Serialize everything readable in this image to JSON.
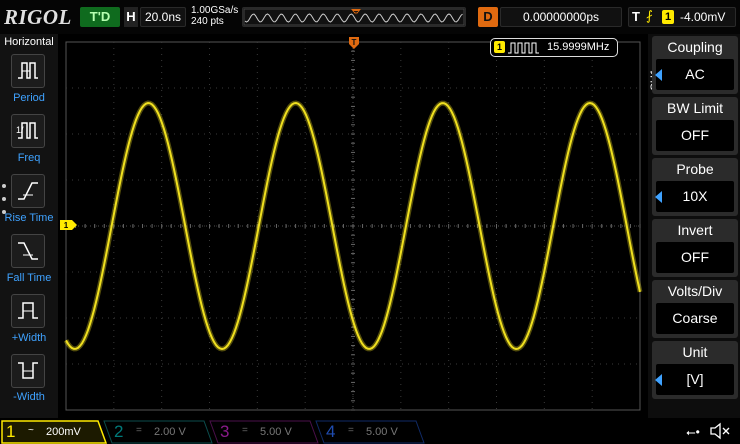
{
  "topbar": {
    "logo": "RIGOL",
    "status": "T'D",
    "timebase_label": "H",
    "timebase_value": "20.0ns",
    "sample_rate": "1.00GSa/s",
    "points": "240 pts",
    "delay_label": "D",
    "delay_value": "0.00000000ps",
    "trigger_label": "T",
    "trigger_source": "1",
    "trigger_level": "-4.00mV"
  },
  "left_panel": {
    "title": "Horizontal",
    "items": [
      {
        "label": "Period",
        "icon": "period-icon"
      },
      {
        "label": "Freq",
        "icon": "frequency-icon"
      },
      {
        "label": "Rise Time",
        "icon": "rise-time-icon"
      },
      {
        "label": "Fall Time",
        "icon": "fall-time-icon"
      },
      {
        "label": "+Width",
        "icon": "positive-width-icon"
      },
      {
        "label": "-Width",
        "icon": "negative-width-icon"
      }
    ]
  },
  "screen": {
    "frequency_readout": "15.9999MHz",
    "frequency_channel": "1",
    "channel_marker": "1",
    "trigger_marker": "T",
    "trace_color": "#f0e020",
    "waveform": {
      "type": "sine",
      "cycles_visible": 3.9
    }
  },
  "right_panel": {
    "channel": "CH1",
    "items": [
      {
        "title": "Coupling",
        "value": "AC",
        "arrow": true
      },
      {
        "title": "BW Limit",
        "value": "OFF",
        "arrow": false
      },
      {
        "title": "Probe",
        "value": "10X",
        "arrow": true
      },
      {
        "title": "Invert",
        "value": "OFF",
        "arrow": false
      },
      {
        "title": "Volts/Div",
        "value": "Coarse",
        "arrow": false
      },
      {
        "title": "Unit",
        "value": "[V]",
        "arrow": true
      }
    ]
  },
  "bottombar": {
    "channels": [
      {
        "num": "1",
        "coupling": "~",
        "scale": "200mV",
        "color": "#ffea00",
        "active": true
      },
      {
        "num": "2",
        "coupling": "=",
        "scale": "2.00 V",
        "color": "#00c8c8",
        "active": false
      },
      {
        "num": "3",
        "coupling": "=",
        "scale": "5.00 V",
        "color": "#d020d0",
        "active": false
      },
      {
        "num": "4",
        "coupling": "=",
        "scale": "5.00 V",
        "color": "#2b6cff",
        "active": false
      }
    ]
  },
  "colors": {
    "ch1": "#ffea00",
    "accent_blue": "#3fa2ff",
    "trigger_orange": "#e06a10",
    "status_green": "#0f6b1e"
  }
}
